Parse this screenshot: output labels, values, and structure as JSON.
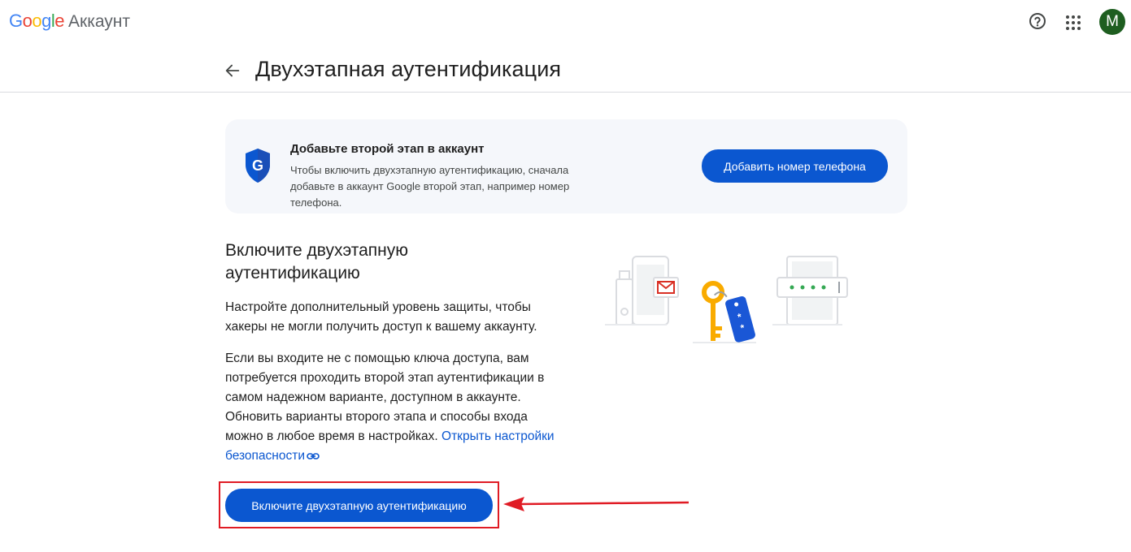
{
  "topbar": {
    "logo_letters": [
      "G",
      "o",
      "o",
      "g",
      "l",
      "e"
    ],
    "logo_colors": [
      "#4285F4",
      "#EA4335",
      "#FBBC05",
      "#4285F4",
      "#34A853",
      "#EA4335"
    ],
    "product": "Аккаунт",
    "help_icon": "help-icon",
    "apps_icon": "apps-grid-icon",
    "avatar_letter": "M",
    "avatar_color": "#1e5e20"
  },
  "header": {
    "back_icon": "arrow-back-icon",
    "title": "Двухэтапная аутентификация"
  },
  "banner": {
    "icon": "google-shield-icon",
    "title": "Добавьте второй этап в аккаунт",
    "text": "Чтобы включить двухэтапную аутентификацию, сначала добавьте в аккаунт Google второй этап, например номер телефона.",
    "button_label": "Добавить номер телефона"
  },
  "main": {
    "title": "Включите двухэтапную аутентификацию",
    "para1": "Настройте дополнительный уровень защиты, чтобы хакеры не могли получить доступ к вашему аккаунту.",
    "para2": "Если вы входите не с помощью ключа доступа, вам потребуется проходить второй этап аутентификации в самом надежном варианте, доступном в аккаунте. Обновить варианты второго этапа и способы входа можно в любое время в настройках.",
    "link_label": "Открыть настройки безопасности",
    "link_icon": "link-icon",
    "button_label": "Включите двухэтапную аутентификацию",
    "accent_color": "#0b57d0",
    "annotation_color": "#e01b24"
  }
}
